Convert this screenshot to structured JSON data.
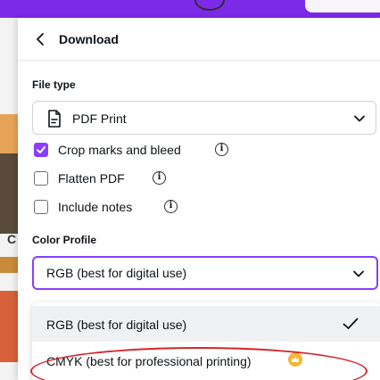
{
  "header": {
    "title": "Download"
  },
  "file_type": {
    "label": "File type",
    "selected": "PDF Print"
  },
  "options": [
    {
      "label": "Crop marks and bleed",
      "checked": true
    },
    {
      "label": "Flatten PDF",
      "checked": false
    },
    {
      "label": "Include notes",
      "checked": false
    }
  ],
  "color_profile": {
    "label": "Color Profile",
    "selected": "RGB (best for digital use)",
    "dropdown": [
      {
        "label": "RGB (best for digital use)",
        "selected": true
      },
      {
        "label": "CMYK (best for professional printing)",
        "selected": false,
        "badge": "crown-icon"
      }
    ]
  },
  "background": {
    "left_letter": "C"
  },
  "colors": {
    "accent": "#8b3dff",
    "annotation": "#d6242d",
    "canvas_bar": "#7d2ae8"
  }
}
